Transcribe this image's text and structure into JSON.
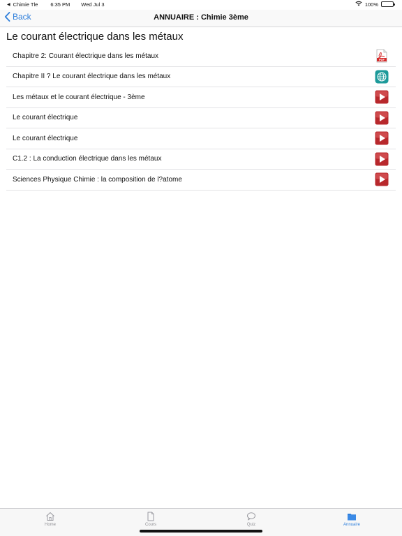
{
  "status_bar": {
    "back_app": "Chimie Tle",
    "time": "6:35 PM",
    "date": "Wed Jul 3",
    "battery": "100%"
  },
  "nav": {
    "back_label": "Back",
    "title": "ANNUAIRE : Chimie 3ème"
  },
  "page": {
    "heading": "Le courant électrique dans les métaux"
  },
  "items": [
    {
      "label": "Chapitre 2: Courant électrique dans les métaux",
      "icon": "pdf-icon"
    },
    {
      "label": "Chapitre II ? Le courant électrique dans les métaux",
      "icon": "web-globe-icon"
    },
    {
      "label": "Les métaux et le courant électrique - 3ème",
      "icon": "video-play-icon"
    },
    {
      "label": "Le courant électrique",
      "icon": "video-play-icon"
    },
    {
      "label": "Le courant électrique",
      "icon": "video-play-icon"
    },
    {
      "label": "C1.2 : La conduction électrique dans les métaux",
      "icon": "video-play-icon"
    },
    {
      "label": "Sciences Physique Chimie : la composition de l?atome",
      "icon": "video-play-icon"
    }
  ],
  "tabs": [
    {
      "label": "Home",
      "icon": "home-icon",
      "active": false
    },
    {
      "label": "Cours",
      "icon": "document-icon",
      "active": false
    },
    {
      "label": "Quiz",
      "icon": "chat-bubble-icon",
      "active": false
    },
    {
      "label": "Annuaire",
      "icon": "folder-icon",
      "active": true
    }
  ],
  "colors": {
    "accent": "#2f7fdb",
    "play_red": "#b8282c",
    "globe_teal": "#1d9a9a",
    "pdf_red": "#d62b2b"
  }
}
